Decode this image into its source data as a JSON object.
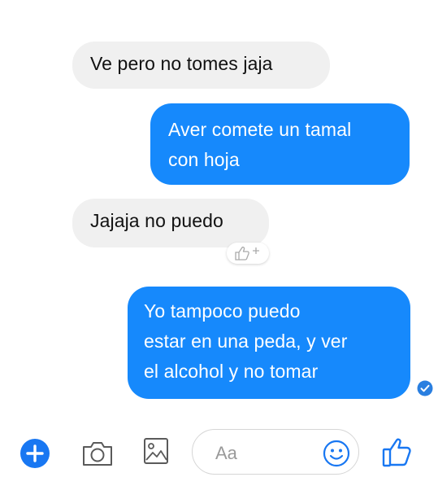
{
  "conversation": {
    "messages": [
      {
        "direction": "incoming",
        "text": "Ve pero no tomes jaja"
      },
      {
        "direction": "outgoing",
        "text": "Aver comete un tamal\ncon hoja"
      },
      {
        "direction": "incoming",
        "text": "Jajaja no puedo"
      },
      {
        "direction": "outgoing",
        "text": "Yo tampoco puedo\nestar en una peda, y ver\nel alcohol y no tomar"
      }
    ],
    "reaction_icon": "thumbs-up-add-reaction-icon",
    "read_receipt_icon": "check-circle-icon"
  },
  "composer": {
    "placeholder": "Aa",
    "icons": [
      "plus-icon",
      "camera-icon",
      "image-icon",
      "emoji-icon",
      "thumbs-up-icon"
    ]
  },
  "colors": {
    "outgoing_bubble": "#1689fc",
    "incoming_bubble": "#f0f0f0",
    "accent": "#1877f2"
  }
}
